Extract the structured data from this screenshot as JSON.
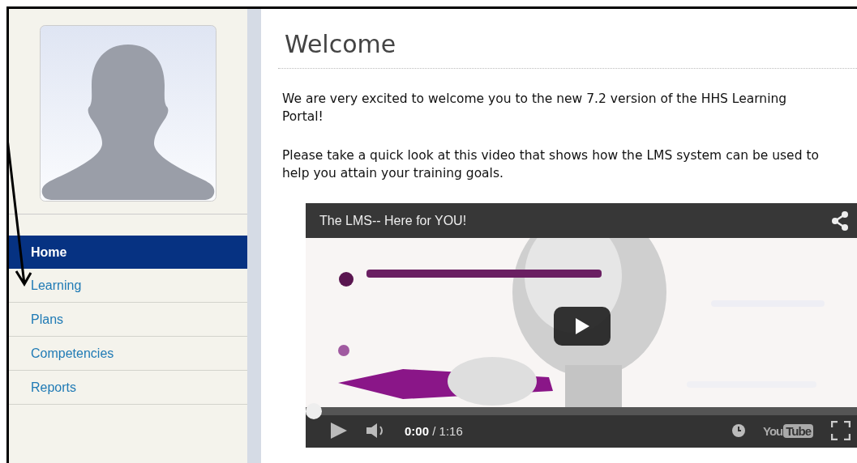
{
  "sidebar": {
    "items": [
      {
        "label": "Home",
        "selected": true
      },
      {
        "label": "Learning",
        "selected": false
      },
      {
        "label": "Plans",
        "selected": false
      },
      {
        "label": "Competencies",
        "selected": false
      },
      {
        "label": "Reports",
        "selected": false
      }
    ]
  },
  "page": {
    "title": "Welcome",
    "paragraphs": [
      "We are very excited to welcome you to the new 7.2 version of the HHS Learning Portal!",
      "Please take a quick look at this video that shows how the LMS system can be used to help you attain your training goals."
    ]
  },
  "video": {
    "title": "The LMS-- Here for YOU!",
    "progress": {
      "level": 0
    },
    "time_current": "0:00",
    "time_total": "/ 1:16",
    "logo": [
      "You",
      "Tube"
    ]
  }
}
